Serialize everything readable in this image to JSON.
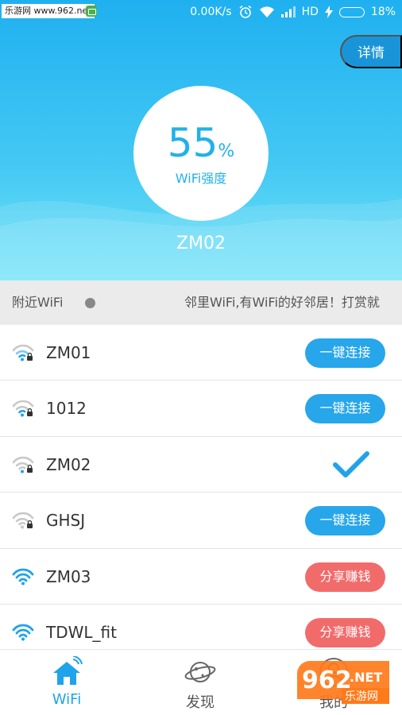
{
  "status_bar": {
    "watermark": "乐游网 www.962.net",
    "net_speed": "0.00K/s",
    "network": "HD",
    "battery": "18%",
    "battery_level": 0.18
  },
  "header": {
    "detail_button": "详情",
    "strength_value": "55",
    "strength_unit": "%",
    "strength_label": "WiFi强度",
    "connected_ssid": "ZM02"
  },
  "nearby": {
    "label": "附近WiFi",
    "marquee": "邻里WiFi,有WiFi的好邻居！打赏就"
  },
  "wifi_list": [
    {
      "name": "ZM01",
      "action": "一键连接",
      "type": "connect"
    },
    {
      "name": "1012",
      "action": "一键连接",
      "type": "connect"
    },
    {
      "name": "ZM02",
      "action": "",
      "type": "connected"
    },
    {
      "name": "GHSJ",
      "action": "一键连接",
      "type": "connect"
    },
    {
      "name": "ZM03",
      "action": "分享赚钱",
      "type": "share"
    },
    {
      "name": "TDWL_fit",
      "action": "分享赚钱",
      "type": "share"
    }
  ],
  "bottom_nav": {
    "wifi": "WiFi",
    "discover": "发现",
    "me": "我的"
  },
  "watermark_logo": {
    "number": "962",
    "suffix": ".NET",
    "cn": "乐游网"
  },
  "colors": {
    "accent": "#1fa3ea",
    "connect": "#27a6ea",
    "share": "#f26b6b"
  }
}
